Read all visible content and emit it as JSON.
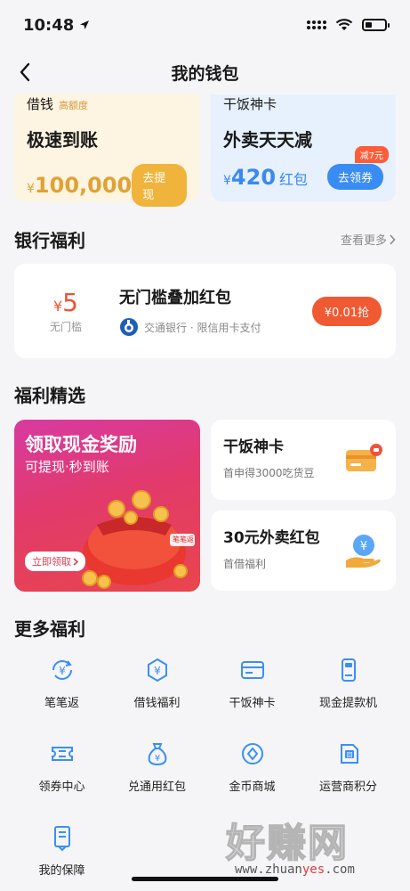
{
  "status_bar": {
    "time": "10:48"
  },
  "nav": {
    "title": "我的钱包"
  },
  "loan_card": {
    "label": "借钱",
    "tag": "高额度",
    "subtitle": "极速到账",
    "currency": "¥",
    "amount": "100,000",
    "button": "去提现"
  },
  "shenka_card": {
    "label": "干饭神卡",
    "subtitle": "外卖天天减",
    "currency": "¥",
    "amount": "420",
    "unit": "红包",
    "badge": "减7元",
    "button": "去领券"
  },
  "bank_section": {
    "title": "银行福利",
    "more": "查看更多",
    "coupon": {
      "currency": "¥",
      "amount": "5",
      "threshold": "无门槛",
      "title": "无门槛叠加红包",
      "desc": "交通银行 · 限信用卡支付",
      "button": "¥0.01抢"
    }
  },
  "featured_section": {
    "title": "福利精选",
    "banner": {
      "title": "领取现金奖励",
      "subtitle": "可提现·秒到账",
      "button": "立即领取",
      "bag_label": "笔笔返"
    },
    "cards": [
      {
        "title": "干饭神卡",
        "subtitle": "首申得3000吃货豆"
      },
      {
        "title": "30元外卖红包",
        "subtitle": "首借福利"
      }
    ]
  },
  "more_section": {
    "title": "更多福利",
    "items": [
      {
        "label": "笔笔返",
        "icon": "yen-cycle-icon"
      },
      {
        "label": "借钱福利",
        "icon": "yen-hexagon-icon"
      },
      {
        "label": "干饭神卡",
        "icon": "card-icon"
      },
      {
        "label": "现金提款机",
        "icon": "atm-icon"
      },
      {
        "label": "领券中心",
        "icon": "ticket-icon"
      },
      {
        "label": "兑通用红包",
        "icon": "money-bag-icon"
      },
      {
        "label": "金币商城",
        "icon": "coin-icon"
      },
      {
        "label": "运营商积分",
        "icon": "sim-card-icon"
      },
      {
        "label": "我的保障",
        "icon": "document-icon"
      }
    ]
  },
  "watermark": {
    "text": "好赚网",
    "url_prefix": "www.zhuan",
    "url_highlight": "yes",
    "url_suffix": ".com"
  },
  "colors": {
    "gold": "#f0b43c",
    "blue": "#3a8cf5",
    "red": "#f05a33",
    "icon_blue": "#3a8ff5"
  }
}
